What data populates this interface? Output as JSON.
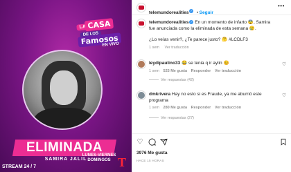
{
  "promo": {
    "logo_la": "LA",
    "logo_casa": "CASA",
    "logo_de": "DE LOS",
    "logo_famosos": "Famosos",
    "logo_envivo": "EN VIVO",
    "banner": "ELIMINADA",
    "name": "SAMIRA JALIL",
    "stream": "STREAM 24 / 7",
    "schedule": "LUNES-VIERNES DOMINGOS",
    "channel_logo": "T"
  },
  "post": {
    "account": "telemundorealities",
    "follow_label": "Seguir",
    "more_icon": "•••",
    "caption_line1": "En un momento de infarto 😨, Samira",
    "caption_line2": "fue anunciada como la eliminada de esta semana 😢.",
    "caption_line3": "¿Lo veías venir?, ¿Te parece justo? 🤔 #LCDLF3",
    "caption_time": "1 sem",
    "caption_translate": "Ver traducción"
  },
  "comments": [
    {
      "user": "leydipaulino33",
      "text": "😂 se tenia q ir aylin 😊",
      "time": "1 sem",
      "likes": "525 Me gusta",
      "reply": "Responder",
      "translate": "Ver traducción",
      "replies": "Ver respuestas (42)"
    },
    {
      "user": "dmkrivera",
      "text_line1": "Hay no esto si es Fraude, ya me aburrió este",
      "text_line2": "programa",
      "time": "1 sem",
      "likes": "280 Me gusta",
      "reply": "Responder",
      "translate": "Ver traducción",
      "replies": "Ver respuestas (27)"
    }
  ],
  "actions": {
    "like_icon": "♡",
    "comment_icon": "○",
    "share_icon": "➤",
    "save_icon": "▯",
    "likes_count": "3976 Me gusta",
    "posted_ago": "HACE 15 HORAS"
  }
}
